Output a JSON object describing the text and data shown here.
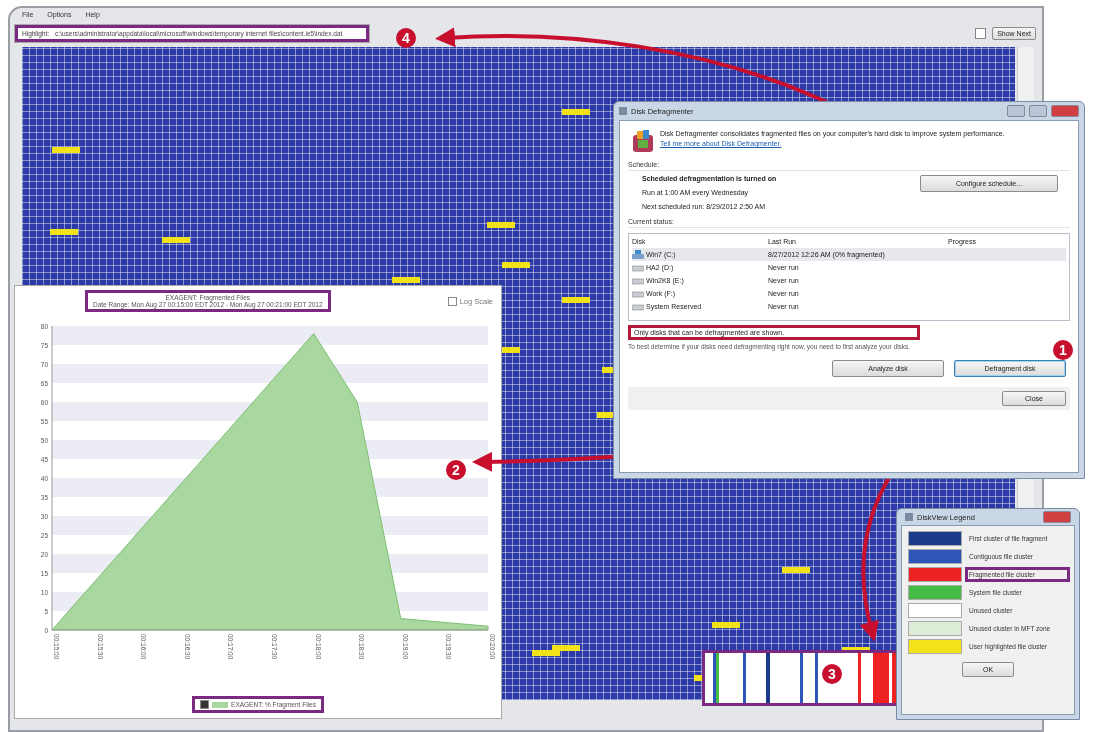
{
  "main_window": {
    "menu": [
      "File",
      "Options",
      "Help"
    ],
    "highlight": {
      "label": "Highlight:",
      "value": "c:\\users\\administrator\\appdata\\local\\microsoft\\windows\\temporary internet files\\content.ie5\\index.dat",
      "framed": true
    },
    "show_next": {
      "label": "Show Next",
      "checked": false
    }
  },
  "chart_window": {
    "title": "EXAGENT: Fragmented Files",
    "subtitle": "Date Range: Mon Aug 27 00:15:00 EDT 2012 - Mon Aug 27 00:21:00 EDT 2012",
    "framed": true,
    "log_scale": {
      "label": "Log Scale",
      "checked": false
    },
    "chart_data": {
      "type": "area",
      "categories": [
        "00:15:00",
        "00:15:30",
        "00:16:00",
        "00:16:30",
        "00:17:00",
        "00:17:30",
        "00:18:00",
        "00:18:30",
        "00:19:00",
        "00:19:30",
        "00:20:00"
      ],
      "series": [
        {
          "name": "EXAGENT: % Fragment Files",
          "color": "#a8d8a0",
          "values": [
            0,
            13,
            26,
            39,
            52,
            65,
            78,
            60,
            3,
            2,
            1
          ]
        }
      ],
      "ylim": [
        0,
        80
      ],
      "yticks": [
        0,
        5,
        10,
        15,
        20,
        25,
        30,
        35,
        40,
        45,
        50,
        55,
        60,
        65,
        70,
        75,
        80
      ]
    },
    "legend": {
      "checked": true,
      "framed": true
    }
  },
  "defrag_window": {
    "title": "Disk Defragmenter",
    "intro": "Disk Defragmenter consolidates fragmented files on your computer's hard disk to improve system performance.",
    "link": "Tell me more about Disk Defragmenter.",
    "schedule_heading": "Schedule:",
    "schedule_lines": [
      "Scheduled defragmentation is turned on",
      "Run at 1:00 AM every Wednesday",
      "Next scheduled run: 8/29/2012 2:50 AM"
    ],
    "configure_button": "Configure schedule...",
    "status_heading": "Current status:",
    "columns": [
      "Disk",
      "Last Run",
      "Progress"
    ],
    "disks": [
      {
        "name": "Win7 (C:)",
        "last_run": "8/27/2012 12:26 AM (0% fragmented)",
        "selected": true,
        "kind": "system"
      },
      {
        "name": "HA2 (D:)",
        "last_run": "Never run",
        "selected": false,
        "kind": "drive"
      },
      {
        "name": "Win2K8 (E:)",
        "last_run": "Never run",
        "selected": false,
        "kind": "drive"
      },
      {
        "name": "Work (F:)",
        "last_run": "Never run",
        "selected": false,
        "kind": "drive"
      },
      {
        "name": "System Reserved",
        "last_run": "Never run",
        "selected": false,
        "kind": "drive"
      }
    ],
    "note": {
      "text": "Only disks that can be defragmented are shown.",
      "framed": true
    },
    "hint": "To best determine if your disks need defragmenting right now, you need to first analyze your disks.",
    "analyze_button": "Analyze disk",
    "defragment_button": "Defragment disk",
    "close_button": "Close"
  },
  "legend_window": {
    "title": "DiskView Legend",
    "items": [
      {
        "label": "First cluster of file fragment",
        "color": "#1a3a8c",
        "framed": false
      },
      {
        "label": "Contiguous file cluster",
        "color": "#2f55b8",
        "framed": false
      },
      {
        "label": "Fragmented file cluster",
        "color": "#ee2222",
        "framed": true
      },
      {
        "label": "System file cluster",
        "color": "#44bb44",
        "framed": false
      },
      {
        "label": "Unused cluster",
        "color": "#ffffff",
        "framed": false
      },
      {
        "label": "Unused cluster in MFT zone",
        "color": "#dcecd6",
        "framed": false
      },
      {
        "label": "User highlighted file cluster",
        "color": "#f2e21a",
        "framed": false
      }
    ],
    "ok_button": "OK"
  },
  "disk_strip": {
    "framed": true
  },
  "callouts": [
    {
      "label": "1"
    },
    {
      "label": "2"
    },
    {
      "label": "3"
    },
    {
      "label": "4"
    }
  ]
}
